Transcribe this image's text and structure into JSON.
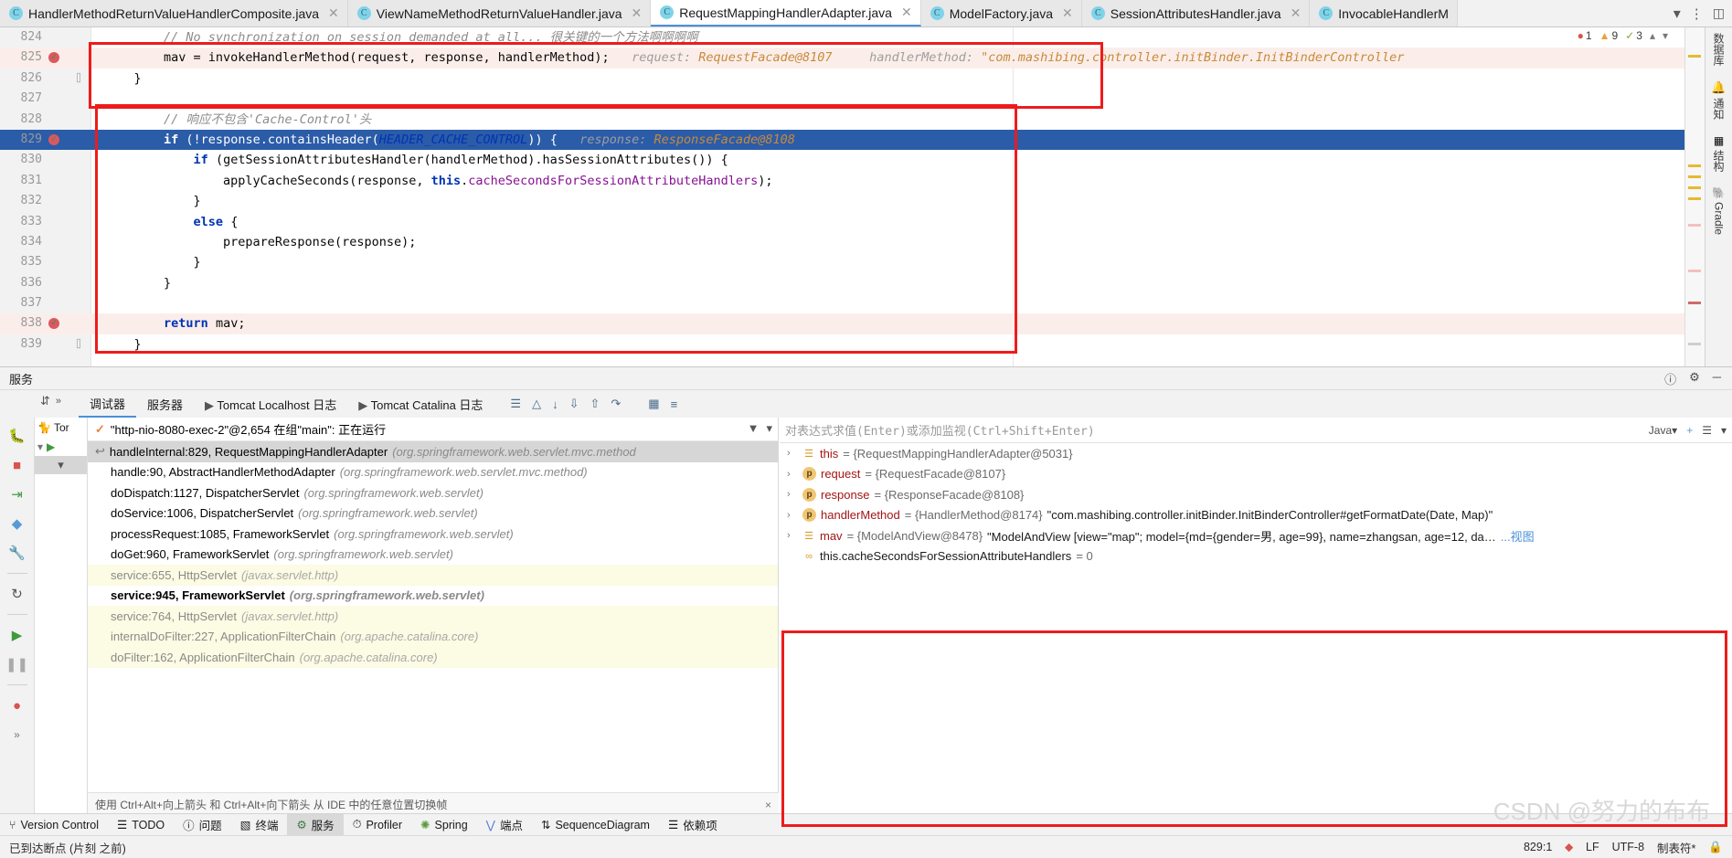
{
  "tabs": [
    {
      "label": "HandlerMethodReturnValueHandlerComposite.java",
      "active": false,
      "icon": "java-class-icon"
    },
    {
      "label": "ViewNameMethodReturnValueHandler.java",
      "active": false,
      "icon": "java-class-icon"
    },
    {
      "label": "RequestMappingHandlerAdapter.java",
      "active": true,
      "icon": "java-class-icon"
    },
    {
      "label": "ModelFactory.java",
      "active": false,
      "icon": "java-class-icon"
    },
    {
      "label": "SessionAttributesHandler.java",
      "active": false,
      "icon": "java-class-icon"
    },
    {
      "label": "InvocableHandlerM",
      "active": false,
      "icon": "java-class-icon"
    }
  ],
  "tabbar": {
    "chevron": "⌄",
    "more": "⋮",
    "database_icon": "database-icon"
  },
  "editor": {
    "inspection": {
      "errors": "1",
      "warnings": "9",
      "weak": "3"
    },
    "lines": [
      {
        "num": "824",
        "indent": 0,
        "bp": false,
        "cur": false,
        "exec": false,
        "segments": [
          {
            "t": "        // No synchronization on session demanded at all... ",
            "c": "cmt"
          },
          {
            "t": "很关键的一个方法啊啊啊啊",
            "c": "cmt"
          }
        ]
      },
      {
        "num": "825",
        "indent": 0,
        "bp": true,
        "cur": false,
        "exec": true,
        "segments": [
          {
            "t": "        mav = invokeHandlerMethod(request, response, handlerMethod);",
            "c": "txt"
          },
          {
            "t": "   request: ",
            "c": "hint"
          },
          {
            "t": "RequestFacade@8107",
            "c": "hintv"
          },
          {
            "t": "     handlerMethod: ",
            "c": "hint"
          },
          {
            "t": "\"com.mashibing.controller.initBinder.InitBinderController",
            "c": "hintv"
          }
        ]
      },
      {
        "num": "826",
        "indent": 0,
        "bp": false,
        "cur": false,
        "exec": false,
        "fold": true,
        "segments": [
          {
            "t": "    }",
            "c": "txt"
          }
        ]
      },
      {
        "num": "827",
        "indent": 0,
        "bp": false,
        "cur": false,
        "exec": false,
        "segments": []
      },
      {
        "num": "828",
        "indent": 0,
        "bp": false,
        "cur": false,
        "exec": false,
        "segments": [
          {
            "t": "        // ",
            "c": "cmt"
          },
          {
            "t": "响应不包含'Cache-Control'头",
            "c": "cmt"
          }
        ]
      },
      {
        "num": "829",
        "indent": 0,
        "bp": true,
        "cur": true,
        "exec": false,
        "segments": [
          {
            "t": "        ",
            "c": "txt"
          },
          {
            "t": "if",
            "c": "kw"
          },
          {
            "t": " (!response.containsHeader(",
            "c": "txt"
          },
          {
            "t": "HEADER_CACHE_CONTROL",
            "c": "const"
          },
          {
            "t": ")) {",
            "c": "txt"
          },
          {
            "t": "   response: ",
            "c": "hint"
          },
          {
            "t": "ResponseFacade@8108",
            "c": "hintv"
          }
        ]
      },
      {
        "num": "830",
        "indent": 0,
        "bp": false,
        "cur": false,
        "exec": false,
        "segments": [
          {
            "t": "            ",
            "c": "txt"
          },
          {
            "t": "if",
            "c": "kw"
          },
          {
            "t": " (getSessionAttributesHandler(handlerMethod).hasSessionAttributes()) {",
            "c": "txt"
          }
        ]
      },
      {
        "num": "831",
        "indent": 0,
        "bp": false,
        "cur": false,
        "exec": false,
        "segments": [
          {
            "t": "                applyCacheSeconds(response, ",
            "c": "txt"
          },
          {
            "t": "this",
            "c": "kw"
          },
          {
            "t": ".",
            "c": "txt"
          },
          {
            "t": "cacheSecondsForSessionAttributeHandlers",
            "c": "fld"
          },
          {
            "t": ");",
            "c": "txt"
          }
        ]
      },
      {
        "num": "832",
        "indent": 0,
        "bp": false,
        "cur": false,
        "exec": false,
        "segments": [
          {
            "t": "            }",
            "c": "txt"
          }
        ]
      },
      {
        "num": "833",
        "indent": 0,
        "bp": false,
        "cur": false,
        "exec": false,
        "segments": [
          {
            "t": "            ",
            "c": "txt"
          },
          {
            "t": "else",
            "c": "kw"
          },
          {
            "t": " {",
            "c": "txt"
          }
        ]
      },
      {
        "num": "834",
        "indent": 0,
        "bp": false,
        "cur": false,
        "exec": false,
        "segments": [
          {
            "t": "                prepareResponse(response);",
            "c": "txt"
          }
        ]
      },
      {
        "num": "835",
        "indent": 0,
        "bp": false,
        "cur": false,
        "exec": false,
        "segments": [
          {
            "t": "            }",
            "c": "txt"
          }
        ]
      },
      {
        "num": "836",
        "indent": 0,
        "bp": false,
        "cur": false,
        "exec": false,
        "segments": [
          {
            "t": "        }",
            "c": "txt"
          }
        ]
      },
      {
        "num": "837",
        "indent": 0,
        "bp": false,
        "cur": false,
        "exec": false,
        "segments": []
      },
      {
        "num": "838",
        "indent": 0,
        "bp": true,
        "cur": false,
        "exec": true,
        "segments": [
          {
            "t": "        ",
            "c": "txt"
          },
          {
            "t": "return",
            "c": "kw"
          },
          {
            "t": " mav;",
            "c": "txt"
          }
        ]
      },
      {
        "num": "839",
        "indent": 0,
        "bp": false,
        "cur": false,
        "exec": false,
        "fold": true,
        "segments": [
          {
            "t": "    }",
            "c": "txt"
          }
        ]
      }
    ]
  },
  "right_strip": [
    {
      "label": "数据库",
      "icon": "database-icon"
    },
    {
      "label": "通知",
      "icon": "bell-icon"
    },
    {
      "label": "结构",
      "icon": "structure-icon"
    },
    {
      "label": "Gradle",
      "icon": "gradle-elephant-icon"
    }
  ],
  "services": {
    "title": "服务",
    "header_icons": [
      "help-icon",
      "gear-icon",
      "minimize-icon"
    ],
    "tabs": [
      {
        "label": "调试器",
        "selected": true,
        "icon": null
      },
      {
        "label": "服务器",
        "selected": false,
        "icon": null
      },
      {
        "label": "Tomcat Localhost 日志",
        "selected": false,
        "icon": "console-icon"
      },
      {
        "label": "Tomcat Catalina 日志",
        "selected": false,
        "icon": "console-icon"
      }
    ],
    "toolbar_icons": [
      "layout-icon",
      "restore-layout-icon",
      "export-icon",
      "import-icon",
      "upload-icon",
      "mute-breakpoints-icon",
      "table-icon",
      "settings-lines-icon"
    ],
    "left_icons": [
      "rerun-icon",
      "debug-icon",
      "stop-icon",
      "jump-icon",
      "evaluate-icon",
      "wrench-icon",
      "restart-icon",
      "resume-icon",
      "pause-icon",
      "mute-breakpoints-icon",
      "more-icon"
    ]
  },
  "frames": {
    "thread_label": "\"http-nio-8080-exec-2\"@2,654 在组\"main\": 正在运行",
    "filter_icon": "filter-icon",
    "dropdown_icon": "chevron-down-icon",
    "items": [
      {
        "method": "handleInternal:829, RequestMappingHandlerAdapter",
        "pkg": "(org.springframework.web.servlet.mvc.method",
        "style": "sel",
        "icon": "return-arrow-icon"
      },
      {
        "method": "handle:90, AbstractHandlerMethodAdapter",
        "pkg": "(org.springframework.web.servlet.mvc.method)",
        "style": "normal"
      },
      {
        "method": "doDispatch:1127, DispatcherServlet",
        "pkg": "(org.springframework.web.servlet)",
        "style": "normal"
      },
      {
        "method": "doService:1006, DispatcherServlet",
        "pkg": "(org.springframework.web.servlet)",
        "style": "normal"
      },
      {
        "method": "processRequest:1085, FrameworkServlet",
        "pkg": "(org.springframework.web.servlet)",
        "style": "normal"
      },
      {
        "method": "doGet:960, FrameworkServlet",
        "pkg": "(org.springframework.web.servlet)",
        "style": "normal"
      },
      {
        "method": "service:655, HttpServlet",
        "pkg": "(javax.servlet.http)",
        "style": "lib"
      },
      {
        "method": "service:945, FrameworkServlet",
        "pkg": "(org.springframework.web.servlet)",
        "style": "lib-sel"
      },
      {
        "method": "service:764, HttpServlet",
        "pkg": "(javax.servlet.http)",
        "style": "lib"
      },
      {
        "method": "internalDoFilter:227, ApplicationFilterChain",
        "pkg": "(org.apache.catalina.core)",
        "style": "lib"
      },
      {
        "method": "doFilter:162, ApplicationFilterChain",
        "pkg": "(org.apache.catalina.core)",
        "style": "lib"
      }
    ],
    "hint": "使用 Ctrl+Alt+向上箭头 和 Ctrl+Alt+向下箭头 从 IDE 中的任意位置切换帧",
    "hint_close": "×"
  },
  "variables": {
    "watch_placeholder": "对表达式求值(Enter)或添加监视(Ctrl+Shift+Enter)",
    "lang_label": "Java",
    "add_watch_icon": "add-watch-icon",
    "chevron_icon": "chevron-down-icon",
    "rows": [
      {
        "expand": "›",
        "icon": "object-icon",
        "name": "this",
        "name_color": "red",
        "value": "= {RequestMappingHandlerAdapter@5031}",
        "extra": ""
      },
      {
        "expand": "›",
        "icon": "param-icon",
        "name": "request",
        "name_color": "red",
        "value": "= {RequestFacade@8107}",
        "extra": ""
      },
      {
        "expand": "›",
        "icon": "param-icon",
        "name": "response",
        "name_color": "red",
        "value": "= {ResponseFacade@8108}",
        "extra": ""
      },
      {
        "expand": "›",
        "icon": "param-icon",
        "name": "handlerMethod",
        "name_color": "red",
        "value": "= {HandlerMethod@8174}",
        "extra": "\"com.mashibing.controller.initBinder.InitBinderController#getFormatDate(Date, Map)\""
      },
      {
        "expand": "›",
        "icon": "object-icon",
        "name": "mav",
        "name_color": "red",
        "value": "= {ModelAndView@8478}",
        "extra": "\"ModelAndView [view=\"map\"; model={md={gender=男, age=99}, name=zhangsan, age=12, da…",
        "more": "...视图"
      },
      {
        "expand": "",
        "icon": "field-icon",
        "name": "this.cacheSecondsForSessionAttributeHandlers",
        "name_color": "dark",
        "value": "= 0",
        "extra": ""
      }
    ]
  },
  "bottom_bar": [
    {
      "label": "Version Control",
      "icon": "branch-icon",
      "selected": false
    },
    {
      "label": "TODO",
      "icon": "todo-icon",
      "selected": false
    },
    {
      "label": "问题",
      "icon": "problems-icon",
      "selected": false
    },
    {
      "label": "终端",
      "icon": "terminal-icon",
      "selected": false
    },
    {
      "label": "服务",
      "icon": "services-icon",
      "selected": true
    },
    {
      "label": "Profiler",
      "icon": "profiler-icon",
      "selected": false
    },
    {
      "label": "Spring",
      "icon": "spring-leaf-icon",
      "selected": false
    },
    {
      "label": "端点",
      "icon": "endpoints-icon",
      "selected": false
    },
    {
      "label": "SequenceDiagram",
      "icon": "sequence-diagram-icon",
      "selected": false
    },
    {
      "label": "依赖项",
      "icon": "dependencies-icon",
      "selected": false
    }
  ],
  "status": {
    "message": "已到达断点 (片刻 之前)",
    "caret": "829:1",
    "vcs_icon": "vcs-icon",
    "line_sep": "LF",
    "encoding": "UTF-8",
    "indent": "制表符*",
    "lock_icon": "lock-icon"
  },
  "watermark": "CSDN @努力的布布",
  "colors": {
    "accent": "#4a90d9",
    "annotation_red": "#ee1b1b",
    "current_line": "#2b5ca8",
    "exec_highlight": "#fbeeea"
  }
}
